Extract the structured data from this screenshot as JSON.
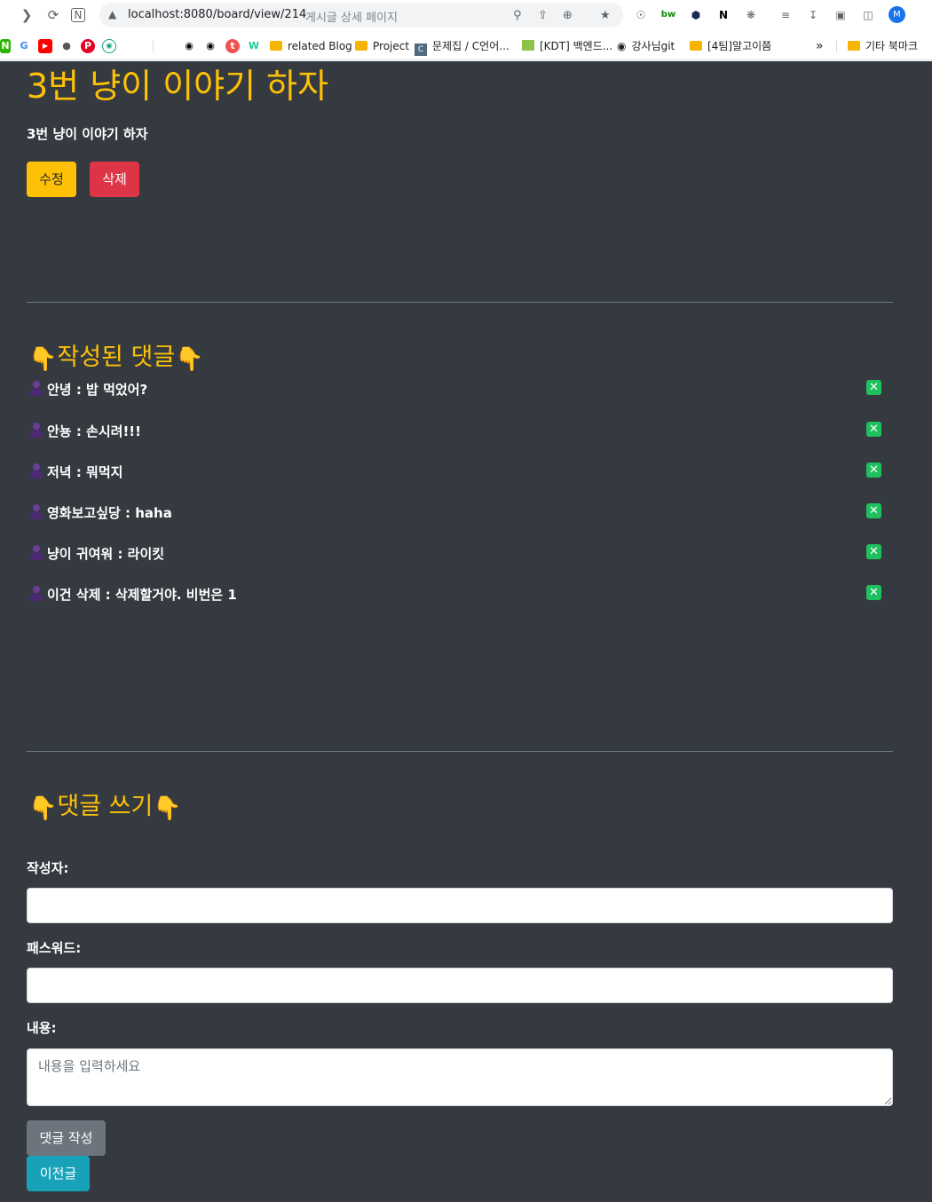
{
  "browser": {
    "url": "localhost:8080/board/view/214",
    "tab_title": "게시글 상세 페이지",
    "profile_initial": "M",
    "bookmarks": {
      "b1": "related Blog",
      "b2": "Project",
      "b3": "문제집 / C언어...",
      "b4": "[KDT] 백엔드...",
      "b5": "강사님git",
      "b6": "[4팀]알고이쯤",
      "overflow": "»",
      "other": "기타 북마크"
    }
  },
  "post": {
    "title": "3번 냥이 이야기 하자",
    "content": "3번 냥이 이야기 하자",
    "edit_label": "수정",
    "delete_label": "삭제"
  },
  "comments_section": {
    "heading": "작성된 댓글",
    "pointer": "👇",
    "delete_icon": "✕",
    "items": [
      {
        "text": "안녕 : 밥 먹었어?"
      },
      {
        "text": "안뇽 : 손시려!!!"
      },
      {
        "text": "저녁 : 뭐먹지"
      },
      {
        "text": "영화보고싶당 : haha"
      },
      {
        "text": "냥이 귀여워 : 라이킷"
      },
      {
        "text": "이건 삭제 : 삭제할거야. 비번은 1"
      }
    ]
  },
  "comment_form": {
    "heading": "댓글 쓰기",
    "writer_label": "작성자:",
    "password_label": "패스워드:",
    "content_label": "내용:",
    "content_placeholder": "내용을 입력하세요",
    "submit_label": "댓글 작성",
    "prev_label": "이전글"
  },
  "colors": {
    "background": "#343a40",
    "accent": "#ffc107",
    "danger": "#dc3545",
    "secondary": "#6c757d",
    "info": "#17a2b8",
    "delete_icon": "#1fc15f"
  }
}
